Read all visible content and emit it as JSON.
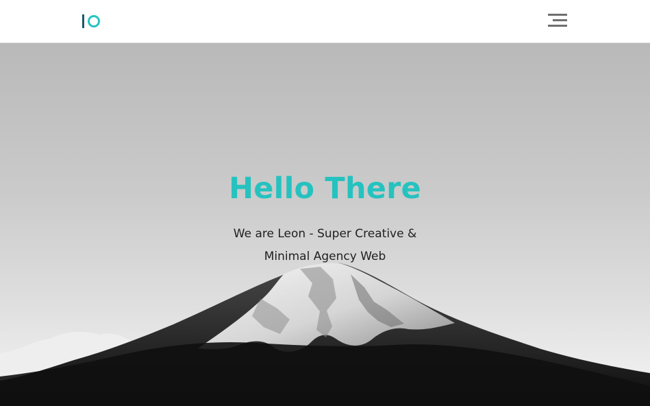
{
  "header": {
    "logo_icon": "io-monogram-logo",
    "menu_icon": "hamburger-menu-icon"
  },
  "hero": {
    "title": "Hello There",
    "tagline_line1": "We are Leon - Super Creative &",
    "tagline_line2": "Minimal Agency Web",
    "background_image": "mountain-landscape-image"
  },
  "colors": {
    "accent": "#25c2bf",
    "logo_dark": "#19596b",
    "text_dark": "#1f1f1f",
    "menu_gray": "#6f6f6f",
    "header_bg": "#ffffff"
  }
}
